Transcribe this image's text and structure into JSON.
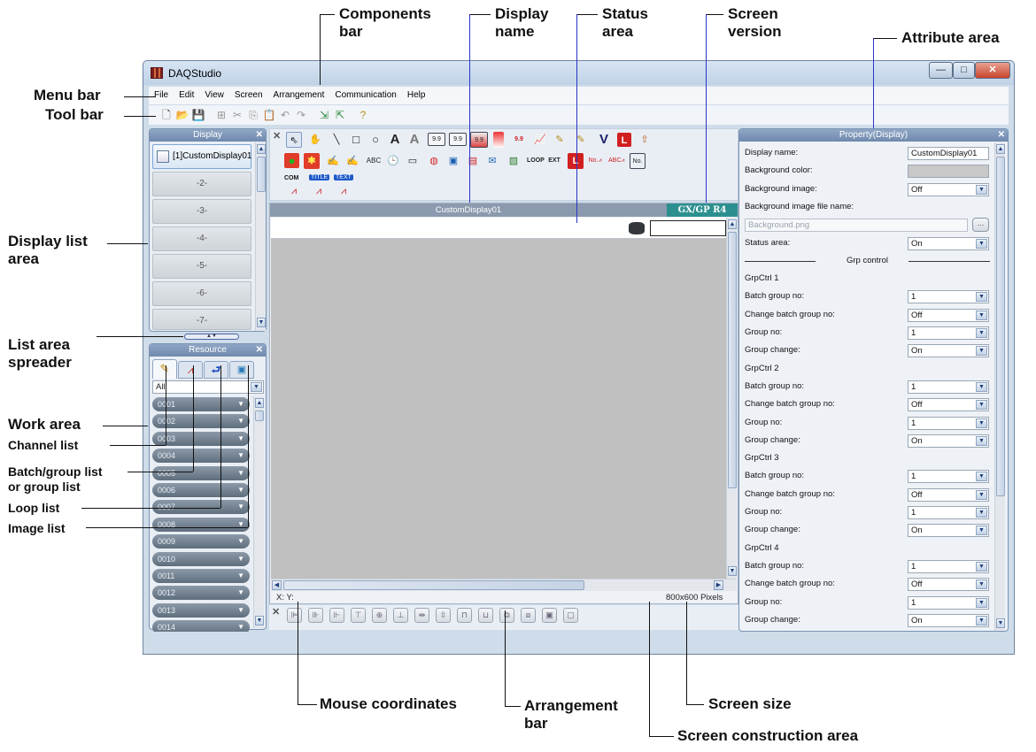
{
  "window": {
    "title": "DAQStudio"
  },
  "menu": [
    "File",
    "Edit",
    "View",
    "Screen",
    "Arrangement",
    "Communication",
    "Help"
  ],
  "display_panel": {
    "title": "Display",
    "items": [
      "[1]CustomDisplay01",
      "-2-",
      "-3-",
      "-4-",
      "-5-",
      "-6-",
      "-7-"
    ]
  },
  "resource_panel": {
    "title": "Resource",
    "filter": "All",
    "channels": [
      "0001",
      "0002",
      "0003",
      "0004",
      "0005",
      "0006",
      "0007",
      "0008",
      "0009",
      "0010",
      "0011",
      "0012",
      "0013",
      "0014"
    ]
  },
  "components": {
    "labels": {
      "com": "COM",
      "title": "TITLE",
      "text": "TEXT"
    }
  },
  "canvas": {
    "display_name": "CustomDisplay01",
    "screen_version": "GX/GP R4",
    "mouse_coords": "X:    Y:",
    "size": "800x600 Pixels"
  },
  "property": {
    "title": "Property(Display)",
    "rows": [
      {
        "label": "Display name:",
        "value": "CustomDisplay01",
        "kind": "text"
      },
      {
        "label": "Background color:",
        "value": "",
        "kind": "color"
      },
      {
        "label": "Background image:",
        "value": "Off",
        "kind": "select"
      },
      {
        "label": "Background image file name:",
        "value": "",
        "kind": "none"
      },
      {
        "label": "",
        "value": "Background.png",
        "kind": "file"
      },
      {
        "label": "Status area:",
        "value": "On",
        "kind": "select"
      },
      {
        "label": "Grp control",
        "value": "",
        "kind": "section"
      },
      {
        "label": "GrpCtrl 1",
        "value": "",
        "kind": "none"
      },
      {
        "label": "Batch group no:",
        "value": "1",
        "kind": "select"
      },
      {
        "label": "Change batch group no:",
        "value": "Off",
        "kind": "select"
      },
      {
        "label": "Group no:",
        "value": "1",
        "kind": "select"
      },
      {
        "label": "Group change:",
        "value": "On",
        "kind": "select"
      },
      {
        "label": "GrpCtrl 2",
        "value": "",
        "kind": "none"
      },
      {
        "label": "Batch group no:",
        "value": "1",
        "kind": "select"
      },
      {
        "label": "Change batch group no:",
        "value": "Off",
        "kind": "select"
      },
      {
        "label": "Group no:",
        "value": "1",
        "kind": "select"
      },
      {
        "label": "Group change:",
        "value": "On",
        "kind": "select"
      },
      {
        "label": "GrpCtrl 3",
        "value": "",
        "kind": "none"
      },
      {
        "label": "Batch group no:",
        "value": "1",
        "kind": "select"
      },
      {
        "label": "Change batch group no:",
        "value": "Off",
        "kind": "select"
      },
      {
        "label": "Group no:",
        "value": "1",
        "kind": "select"
      },
      {
        "label": "Group change:",
        "value": "On",
        "kind": "select"
      },
      {
        "label": "GrpCtrl 4",
        "value": "",
        "kind": "none"
      },
      {
        "label": "Batch group no:",
        "value": "1",
        "kind": "select"
      },
      {
        "label": "Change batch group no:",
        "value": "Off",
        "kind": "select"
      },
      {
        "label": "Group no:",
        "value": "1",
        "kind": "select"
      },
      {
        "label": "Group change:",
        "value": "On",
        "kind": "select"
      }
    ]
  },
  "annotations": {
    "components_bar": [
      "Components",
      "bar"
    ],
    "display_name": [
      "Display",
      "name"
    ],
    "status_area": [
      "Status",
      "area"
    ],
    "screen_version": [
      "Screen",
      "version"
    ],
    "attribute_area": "Attribute area",
    "menu_bar": "Menu bar",
    "tool_bar": "Tool bar",
    "display_list_area": [
      "Display list",
      "area"
    ],
    "list_area_spreader": [
      "List area",
      "spreader"
    ],
    "work_area": "Work area",
    "channel_list": "Channel list",
    "batch_group_list": [
      "Batch/group list",
      "or group list"
    ],
    "loop_list": "Loop list",
    "image_list": "Image list",
    "mouse_coordinates": "Mouse coordinates",
    "arrangement_bar": [
      "Arrangement",
      "bar"
    ],
    "screen_size": "Screen size",
    "screen_construction_area": "Screen construction area"
  }
}
